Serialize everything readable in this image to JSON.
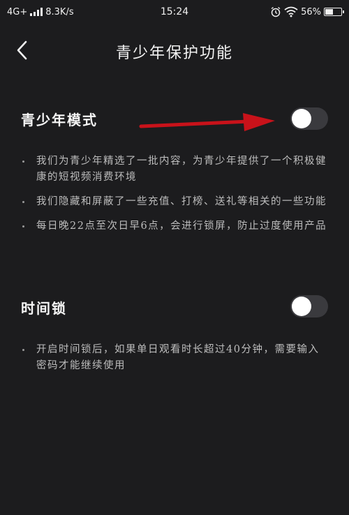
{
  "status_bar": {
    "network": "4G+",
    "speed": "8.3K/s",
    "time": "15:24",
    "battery": "56%",
    "battery_level": 0.56,
    "icons": [
      "signal-icon",
      "alarm-icon",
      "wifi-icon",
      "battery-icon"
    ]
  },
  "header": {
    "title": "青少年保护功能",
    "back_icon": "chevron-left-icon"
  },
  "youth_mode": {
    "title": "青少年模式",
    "toggle_on": false,
    "bullets": [
      "我们为青少年精选了一批内容，为青少年提供了一个积极健康的短视频消费环境",
      "我们隐藏和屏蔽了一些充值、打榜、送礼等相关的一些功能",
      "每日晚22点至次日早6点，会进行锁屏，防止过度使用产品"
    ]
  },
  "time_lock": {
    "title": "时间锁",
    "toggle_on": false,
    "bullets": [
      "开启时间锁后，如果单日观看时长超过40分钟，需要输入密码才能继续使用"
    ]
  },
  "colors": {
    "background": "#1c1c1e",
    "toggle_track": "#3a3a3e",
    "arrow": "#c8121a"
  }
}
